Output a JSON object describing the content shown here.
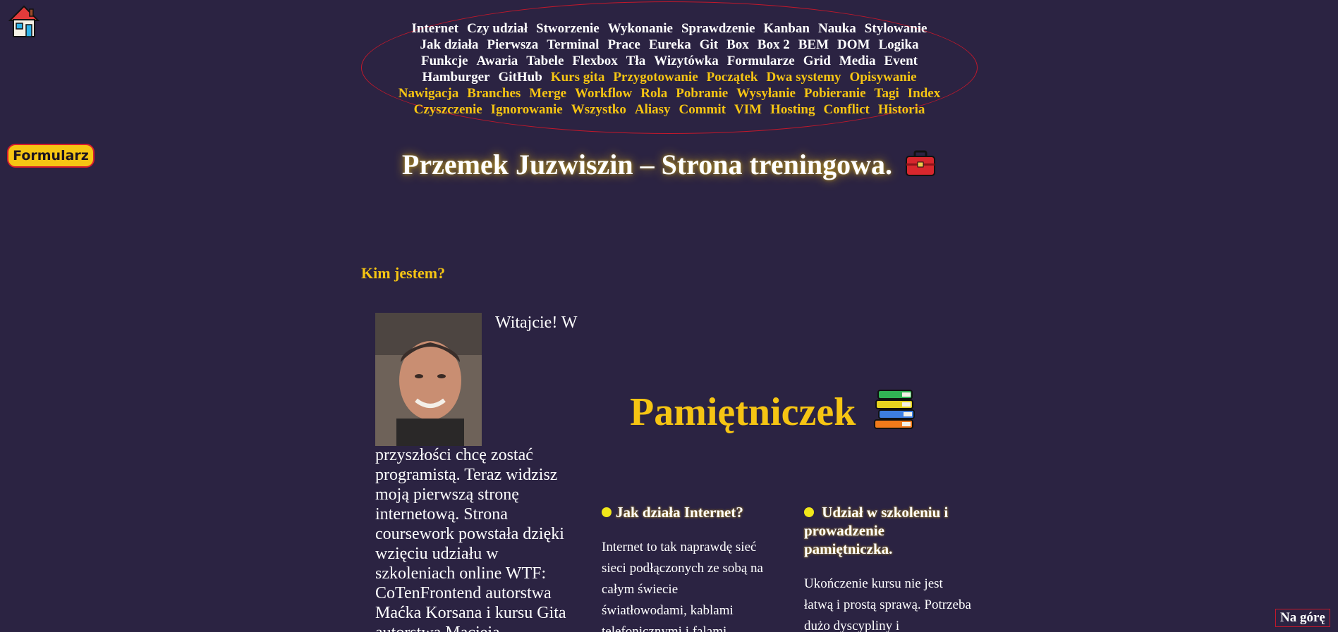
{
  "home": {
    "icon": "house-icon"
  },
  "form_button": {
    "label": "Formularz"
  },
  "nav": {
    "rows": [
      [
        {
          "label": "Internet",
          "y": false
        },
        {
          "label": "Czy udział",
          "y": false
        },
        {
          "label": "Stworzenie",
          "y": false
        },
        {
          "label": "Wykonanie",
          "y": false
        },
        {
          "label": "Sprawdzenie",
          "y": false
        },
        {
          "label": "Kanban",
          "y": false
        },
        {
          "label": "Nauka",
          "y": false
        },
        {
          "label": "Stylowanie",
          "y": false
        }
      ],
      [
        {
          "label": "Jak działa",
          "y": false
        },
        {
          "label": "Pierwsza",
          "y": false
        },
        {
          "label": "Terminal",
          "y": false
        },
        {
          "label": "Prace",
          "y": false
        },
        {
          "label": "Eureka",
          "y": false
        },
        {
          "label": "Git",
          "y": false
        },
        {
          "label": "Box",
          "y": false
        },
        {
          "label": "Box 2",
          "y": false
        },
        {
          "label": "BEM",
          "y": false
        },
        {
          "label": "DOM",
          "y": false
        },
        {
          "label": "Logika",
          "y": false
        }
      ],
      [
        {
          "label": "Funkcje",
          "y": false
        },
        {
          "label": "Awaria",
          "y": false
        },
        {
          "label": "Tabele",
          "y": false
        },
        {
          "label": "Flexbox",
          "y": false
        },
        {
          "label": "Tła",
          "y": false
        },
        {
          "label": "Wizytówka",
          "y": false
        },
        {
          "label": "Formularze",
          "y": false
        },
        {
          "label": "Grid",
          "y": false
        },
        {
          "label": "Media",
          "y": false
        },
        {
          "label": "Event",
          "y": false
        }
      ],
      [
        {
          "label": "Hamburger",
          "y": false
        },
        {
          "label": "GitHub",
          "y": false
        },
        {
          "label": "Kurs gita",
          "y": true
        },
        {
          "label": "Przygotowanie",
          "y": true
        },
        {
          "label": "Początek",
          "y": true
        },
        {
          "label": "Dwa systemy",
          "y": true
        },
        {
          "label": "Opisywanie",
          "y": true
        }
      ],
      [
        {
          "label": "Nawigacja",
          "y": true
        },
        {
          "label": "Branches",
          "y": true
        },
        {
          "label": "Merge",
          "y": true
        },
        {
          "label": "Workflow",
          "y": true
        },
        {
          "label": "Rola",
          "y": true
        },
        {
          "label": "Pobranie",
          "y": true
        },
        {
          "label": "Wysyłanie",
          "y": true
        },
        {
          "label": "Pobieranie",
          "y": true
        },
        {
          "label": "Tagi",
          "y": true
        },
        {
          "label": "Index",
          "y": true
        }
      ],
      [
        {
          "label": "Czyszczenie",
          "y": true
        },
        {
          "label": "Ignorowanie",
          "y": true
        },
        {
          "label": "Wszystko",
          "y": true
        },
        {
          "label": "Aliasy",
          "y": true
        },
        {
          "label": "Commit",
          "y": true
        },
        {
          "label": "VIM",
          "y": true
        },
        {
          "label": "Hosting",
          "y": true
        },
        {
          "label": "Conflict",
          "y": true
        },
        {
          "label": "Historia",
          "y": true
        }
      ]
    ]
  },
  "header": {
    "title": "Przemek Juzwiszin – Strona treningowa.",
    "title_icon": "briefcase-icon"
  },
  "about": {
    "heading": "Kim jestem?",
    "photo_icon": "profile-photo",
    "intro_top": "Witajcie! W",
    "intro_bottom": "przyszłości chcę zostać programistą. Teraz widzisz moją pierwszą stronę internetową. Strona coursework powstała dzięki wzięciu udziału w szkoleniach online WTF: CoTenFrontend autorstwa Maćka Korsana i kursu Gita autorstwa Macieja"
  },
  "diary": {
    "title": "Pamiętniczek",
    "title_icon": "books-icon",
    "col1": {
      "heading": "Jak działa Internet?",
      "text": "Internet to tak naprawdę sieć sieci podłączonych ze sobą na całym świecie światłowodami, kablami telefonicznymi i falami"
    },
    "col2": {
      "heading": "Udział w szkoleniu i prowadzenie pamiętniczka.",
      "text": "Ukończenie kursu nie jest łatwą i prostą sprawą. Potrzeba dużo dyscypliny i"
    }
  },
  "to_top": {
    "label": "Na górę"
  },
  "colors": {
    "background": "#2b2342",
    "accent": "#f6c513",
    "border": "#c2182b"
  }
}
